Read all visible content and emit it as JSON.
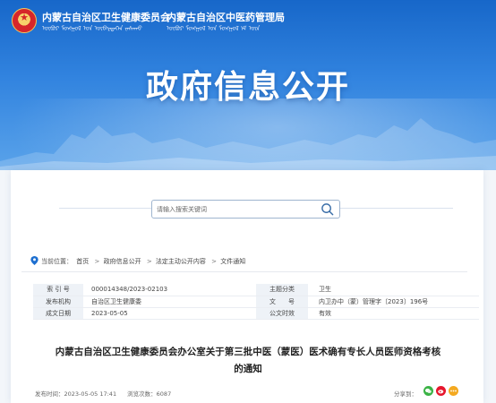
{
  "header": {
    "org1": "内蒙古自治区卫生健康委员会",
    "org2": "内蒙古自治区中医药管理局",
    "org1_mongol": "ᠥᠪᠥᠷ ᠮᠣᠩᠭᠣᠯ ᠤᠨ ᠥᠪᠡᠷᠲᠡᠭᠡᠨ ᠵᠠᠰᠠᠬᠤ",
    "org2_mongol": "ᠥᠪᠥᠷ ᠮᠣᠩᠭᠣᠯ ᠤᠨ ᠮᠣᠩᠭᠣᠯ ᠡᠮ ᠦᠨ",
    "title": "政府信息公开"
  },
  "search": {
    "placeholder": "请输入搜索关键词"
  },
  "breadcrumb": {
    "label": "当前位置：",
    "items": [
      "首页",
      "政府信息公开",
      "法定主动公开内容",
      "文件通知"
    ],
    "separator": ">"
  },
  "info": {
    "index_label": "索 引 号",
    "index_value": "000014348/2023-02103",
    "category_label": "主题分类",
    "category_value": "卫生",
    "issuer_label": "发布机构",
    "issuer_value": "自治区卫生健康委",
    "docno_label": "文　　号",
    "docno_value": "内卫办中（蒙）管理字〔2023〕196号",
    "date_label": "成文日期",
    "date_value": "2023-05-05",
    "validity_label": "公文时效",
    "validity_value": "有效"
  },
  "article": {
    "title_line1": "内蒙古自治区卫生健康委员会办公室关于第三批中医（蒙医）医术确有专长人员医师资格考核",
    "title_line2": "的通知",
    "publish_time": "发布时间：2023-05-05 17:41",
    "views": "浏览次数：6087",
    "share_label": "分享到："
  },
  "colors": {
    "banner": "#1767c9",
    "accent": "#1d6fd0"
  }
}
